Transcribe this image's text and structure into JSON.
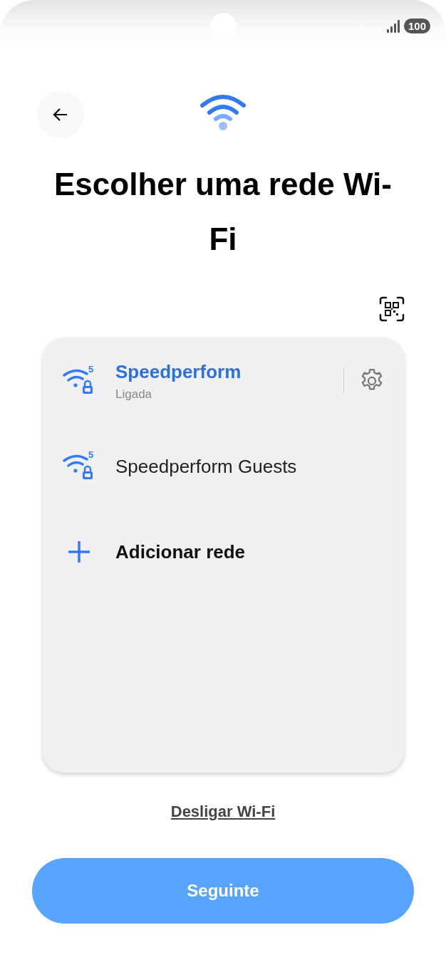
{
  "status_bar": {
    "battery": "100"
  },
  "header": {
    "title": "Escolher uma rede Wi-Fi"
  },
  "networks": [
    {
      "kind": "network",
      "name": "Speedperform",
      "status": "Ligada",
      "band": "5",
      "connected": true
    },
    {
      "kind": "network",
      "name": "Speedperform Guests",
      "band": "5",
      "connected": false
    },
    {
      "kind": "add",
      "name": "Adicionar rede"
    }
  ],
  "link": "Desligar Wi-Fi",
  "button": "Seguinte"
}
